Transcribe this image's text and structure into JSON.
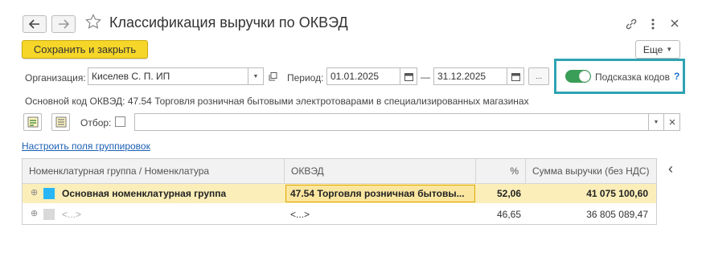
{
  "window": {
    "title": "Классификация выручки по ОКВЭД",
    "icons": [
      "arrow-left-icon",
      "arrow-right-icon",
      "star-icon",
      "link-icon",
      "more-vertical-icon",
      "close-icon"
    ]
  },
  "toolbar": {
    "save_label": "Сохранить и закрыть",
    "more_label": "Еще"
  },
  "filters": {
    "org_label": "Организация:",
    "org_value": "Киселев С. П. ИП",
    "period_label": "Период:",
    "date_from": "01.01.2025",
    "dash": "—",
    "date_to": "31.12.2025",
    "ellipsis": "...",
    "hint_label": "Подсказка кодов",
    "hint_help": "?",
    "hint_enabled": true
  },
  "main_code": "Основной код ОКВЭД: 47.54 Торговля розничная бытовыми электротоварами в специализированных магазинах",
  "selection": {
    "filter_label": "Отбор:",
    "filter_checked": false,
    "filter_value": ""
  },
  "grouping_link": "Настроить поля группировок",
  "table": {
    "columns": [
      "Номенклатурная группа / Номенклатура",
      "ОКВЭД",
      "%",
      "Сумма выручки (без НДС)"
    ],
    "rows": [
      {
        "name": "Основная номенклатурная группа",
        "okved": "47.54 Торговля розничная бытовы...",
        "percent": "52,06",
        "sum": "41 075 100,60",
        "color": "#29b6f6",
        "selected": true
      },
      {
        "name": "<...>",
        "okved": "<...>",
        "percent": "46,65",
        "sum": "36 805 089,47",
        "color": "#d9d9d9",
        "selected": false
      }
    ]
  },
  "side_collapse": "‹"
}
